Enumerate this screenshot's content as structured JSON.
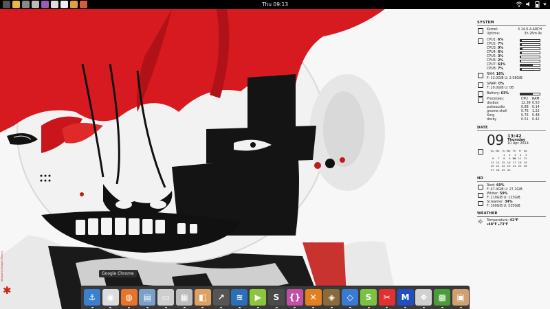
{
  "topbar": {
    "clock": "Thu 09:13",
    "launchers": [
      {
        "icon": "app-grid-icon",
        "color": "#555555"
      },
      {
        "icon": "chrome-icon",
        "color": "#e8b93a"
      },
      {
        "icon": "terminal-icon",
        "color": "#888888"
      },
      {
        "icon": "screenshot-icon",
        "color": "#bbbbbb"
      },
      {
        "icon": "pidgin-icon",
        "color": "#9a5cb5"
      },
      {
        "icon": "window-icon",
        "color": "#dddddd"
      },
      {
        "icon": "document-icon",
        "color": "#eeeeee"
      },
      {
        "icon": "package-icon",
        "color": "#e0a040"
      },
      {
        "icon": "paint-icon",
        "color": "#d06040"
      }
    ]
  },
  "conky": {
    "system_title": "SYSTEM",
    "kernel_label": "Kernel:",
    "kernel_value": "3.14.0-4-ARCH",
    "uptime_label": "Uptime:",
    "uptime_value": "3h 26m 9s",
    "cpus": [
      {
        "label": "CPU1:",
        "value": "6%",
        "fill": 0.06
      },
      {
        "label": "CPU2:",
        "value": "7%",
        "fill": 0.07
      },
      {
        "label": "CPU3:",
        "value": "9%",
        "fill": 0.09
      },
      {
        "label": "CPU4:",
        "value": "6%",
        "fill": 0.06
      },
      {
        "label": "CPU5:",
        "value": "3%",
        "fill": 0.03
      },
      {
        "label": "CPU6:",
        "value": "2%",
        "fill": 0.02
      },
      {
        "label": "CPU7:",
        "value": "63%",
        "fill": 0.63
      },
      {
        "label": "CPU8:",
        "value": "7%",
        "fill": 0.07
      }
    ],
    "ram_label": "RAM:",
    "ram_value": "16%",
    "ram_detail": "F: 13.0GiB U: 2.58GiB",
    "swap_label": "SWAP:",
    "swap_value": "0%",
    "swap_detail": "F: 20.0GiB U: 0B",
    "battery_label": "Battery:",
    "battery_value": "63%",
    "battery_fill": 0.63,
    "processes_label": "Processes:",
    "processes_cols": [
      "CPU",
      "RAM"
    ],
    "processes": [
      {
        "name": "dosbox",
        "cpu": "12.39",
        "ram": "0.50"
      },
      {
        "name": "pulseaudio",
        "cpu": "0.88",
        "ram": "0.14"
      },
      {
        "name": "gnome-shell",
        "cpu": "0.76",
        "ram": "1.22"
      },
      {
        "name": "Xorg",
        "cpu": "0.76",
        "ram": "0.48"
      },
      {
        "name": "docky",
        "cpu": "0.51",
        "ram": "0.42"
      }
    ],
    "date_title": "DATE",
    "day_number": "09",
    "time": "13:42",
    "weekday": "Thursday",
    "full_date": "10 Apr 2014",
    "cal_header": [
      "Su",
      "Mo",
      "Tu",
      "We",
      "Th",
      "Fr",
      "Sa"
    ],
    "cal_rows": [
      [
        "",
        "",
        "1",
        "2",
        "3",
        "4",
        "5"
      ],
      [
        "6",
        "7",
        "8",
        "9",
        "10",
        "11",
        "12"
      ],
      [
        "13",
        "14",
        "15",
        "16",
        "17",
        "18",
        "19"
      ],
      [
        "20",
        "21",
        "22",
        "23",
        "24",
        "25",
        "26"
      ],
      [
        "27",
        "28",
        "29",
        "30",
        "",
        "",
        ""
      ]
    ],
    "cal_today": "10",
    "hd_title": "HD",
    "drives": [
      {
        "name": "Root:",
        "pct": "60%",
        "detail": "F: 47.4GiB U: 27.2GiB"
      },
      {
        "name": "Whiter:",
        "pct": "59%",
        "detail": "F: 219GiB U: 133GiB"
      },
      {
        "name": "Screamer:",
        "pct": "34%",
        "detail": "F: 300GiB U: 535GiB"
      }
    ],
    "weather_title": "WEATHER",
    "temperature_label": "Temperature:",
    "temperature_value": "42°F",
    "temp_low": "48°F",
    "temp_high": "73°F"
  },
  "dock": {
    "tooltip": "Google Chrome",
    "items": [
      {
        "icon": "anchor-icon",
        "color": "#3b7fd0",
        "glyph": "⚓"
      },
      {
        "icon": "chrome-icon",
        "color": "#dcdcdc",
        "glyph": "◉"
      },
      {
        "icon": "firefox-icon",
        "color": "#e8742a",
        "glyph": "◍"
      },
      {
        "icon": "scanner-icon",
        "color": "#7aa0c8",
        "glyph": "▤"
      },
      {
        "icon": "files-icon",
        "color": "#cfcfcf",
        "glyph": "▭"
      },
      {
        "icon": "calculator-icon",
        "color": "#bdbdbd",
        "glyph": "▦"
      },
      {
        "icon": "virtualbox-icon",
        "color": "#e0a060",
        "glyph": "◧"
      },
      {
        "icon": "steam-icon",
        "color": "#555555",
        "glyph": "↗"
      },
      {
        "icon": "network-icon",
        "color": "#2a6fb8",
        "glyph": "≋"
      },
      {
        "icon": "play-icon",
        "color": "#8cc63f",
        "glyph": "▶"
      },
      {
        "icon": "sublime-icon",
        "color": "#4a4a4a",
        "glyph": "S"
      },
      {
        "icon": "ide-icon",
        "color": "#c24ea5",
        "glyph": "{}"
      },
      {
        "icon": "xchat-icon",
        "color": "#e08020",
        "glyph": "✕"
      },
      {
        "icon": "dosbox-icon",
        "color": "#8a6a3a",
        "glyph": "◈"
      },
      {
        "icon": "network-manager-icon",
        "color": "#3a7ad0",
        "glyph": "◇"
      },
      {
        "icon": "skype-icon",
        "color": "#7cc142",
        "glyph": "S"
      },
      {
        "icon": "scissors-icon",
        "color": "#e03030",
        "glyph": "✂"
      },
      {
        "icon": "m-icon",
        "color": "#2050c0",
        "glyph": "M"
      },
      {
        "icon": "windows-icon",
        "color": "#d0d0d0",
        "glyph": "❖"
      },
      {
        "icon": "minecraft-icon",
        "color": "#4a9c3a",
        "glyph": "▩"
      },
      {
        "icon": "image-icon",
        "color": "#d0a070",
        "glyph": "▣"
      }
    ]
  },
  "desktop": {
    "side_text": "Nebula's fantastic Munny"
  }
}
